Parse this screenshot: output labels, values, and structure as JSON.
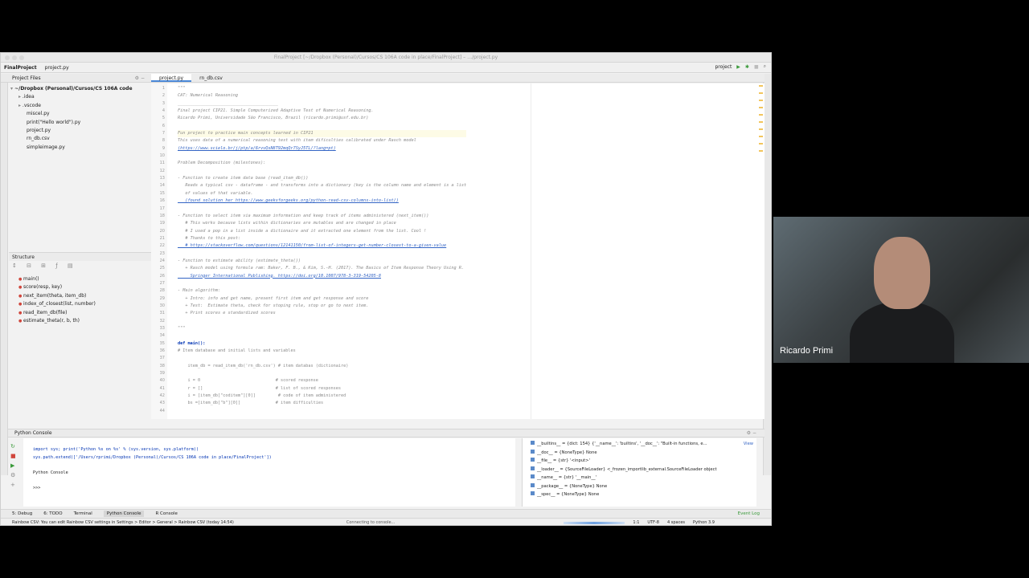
{
  "window": {
    "title": "FinalProject [~/Dropbox (Personal)/Cursos/CS 106A code in place/FinalProject] – …/project.py"
  },
  "navbar": {
    "project": "FinalProject",
    "file": "project.py",
    "run_config": "project"
  },
  "project_panel": {
    "title": "Project Files",
    "root": "~/Dropbox (Personal)/Cursos/CS 106A code",
    "items": [
      ".idea",
      ".vscode",
      "miscel.py",
      "print(\"Hello world\").py",
      "project.py",
      "rn_db.csv",
      "simpleimage.py"
    ]
  },
  "structure": {
    "title": "Structure",
    "items": [
      "main()",
      "score(resp, key)",
      "next_item(theta, item_db)",
      "index_of_closest(list, number)",
      "read_item_db(file)",
      "estimate_theta(r, b, th)"
    ]
  },
  "editor": {
    "tabs": [
      "project.py",
      "rn_db.csv"
    ],
    "line_numbers": [
      "1",
      "2",
      "3",
      "4",
      "5",
      "6",
      "7",
      "8",
      "9",
      "10",
      "11",
      "12",
      "13",
      "14",
      "15",
      "16",
      "17",
      "18",
      "19",
      "20",
      "21",
      "22",
      "23",
      "24",
      "25",
      "26",
      "27",
      "28",
      "29",
      "30",
      "31",
      "32",
      "33",
      "34",
      "35",
      "36",
      "37",
      "38",
      "39",
      "40",
      "41",
      "42",
      "43",
      "44"
    ],
    "lines": [
      "\"\"\"",
      "CAT: Numerical Reasoning",
      "________________________________________",
      "Final project CIP21. Simple Computerized Adaptive Test of Numerical Reasoning.",
      "Ricardo Primi, Universidade São Francisco, Brazil (ricardo.primi@usf.edu.br)",
      "",
      "Fun project to practice main concepts learned in CIP21",
      "This uses data of a numerical reasoning test with item dificulties calibrated under Rasch model",
      "(https://www.scielo.br/j/ptp/a/6rvvQsN8T92mqQr7SyJ5TL/?lang=pt)",
      "",
      "Problem Decomposition (milestones):",
      "",
      "- Function to create item data base (read_item_db())",
      "   Reads a typical csv - dataframe - and transforms into a dictionary (key is the column name and element is a list",
      "   of values of that variable.",
      "   (found solution her https://www.geeksforgeeks.org/python-read-csv-columns-into-list/)",
      "",
      "- Function to select item via maximum information and keep track of items administered (next_item())",
      "   # This works because lists within dictionaries are mutables and are changed in place",
      "   # I used a pop in a list inside a dictionaire and it extracted one element from the list. Cool !",
      "   # Thanks to this post:",
      "   # https://stackoverflow.com/questions/12141150/from-list-of-integers-get-number-closest-to-a-given-value",
      "",
      "- Function to estimate ability (estimate_theta())",
      "   + Rasch model using formula ram: Baker, F. B., & Kim, S.-H. (2017). The Basics of Item Response Theory Using R.",
      "     Springer International Publishing. https://doi.org/10.1007/978-3-319-54205-8",
      "",
      "- Main algorithm:",
      "   + Intro: info and get name, present first item and get response and score",
      "   + Test:  Estimate theta, check for stoping rule, stop or go to next item.",
      "   + Print scores e standardized scores",
      "",
      "\"\"\"",
      "",
      "def main():",
      "# Item database and initial lists and variables",
      "",
      "    item_db = read_item_db('rn_db.csv') # item databas (dictionaire)",
      "",
      "    i = 0                              # scored response",
      "    r = []                             # list of scored responses",
      "    i = [item_db[\"coditem\"][0]]         # code of item administered",
      "    bs =[item_db[\"b\"][0]]              # item difficulties",
      ""
    ]
  },
  "console": {
    "title": "Python Console",
    "lines": [
      "import sys; print('Python %s on %s' % (sys.version, sys.platform))",
      "sys.path.extend(['/Users/rprimi/Dropbox (Personal)/Cursos/CS 106A code in place/FinalProject'])",
      "",
      "Python Console",
      "",
      ">>>"
    ],
    "variables": [
      "__builtins__ = {dict: 154} {'__name__': 'builtins', '__doc__': \"Built-in functions, e...",
      "__doc__ = {NoneType} None",
      "__file__ = {str} '<input>'",
      "__loader__ = {SourceFileLoader} <_frozen_importlib_external.SourceFileLoader object",
      "__name__ = {str} '__main__'",
      "__package__ = {NoneType} None",
      "__spec__ = {NoneType} None"
    ],
    "view_label": "View"
  },
  "bottom_tabs": [
    "5: Debug",
    "6: TODO",
    "Terminal",
    "Python Console",
    "R Console"
  ],
  "event_log": "Event Log",
  "status": {
    "left": "Rainbow CSV: You can edit Rainbow CSV settings in Settings > Editor > General > Rainbow CSV (today 14:54)",
    "mid": "Connecting to console...",
    "position": "1:1",
    "encoding": "UTF-8",
    "indent": "4 spaces",
    "interpreter": "Python 3.9"
  },
  "video": {
    "participant": "Ricardo Primi"
  }
}
